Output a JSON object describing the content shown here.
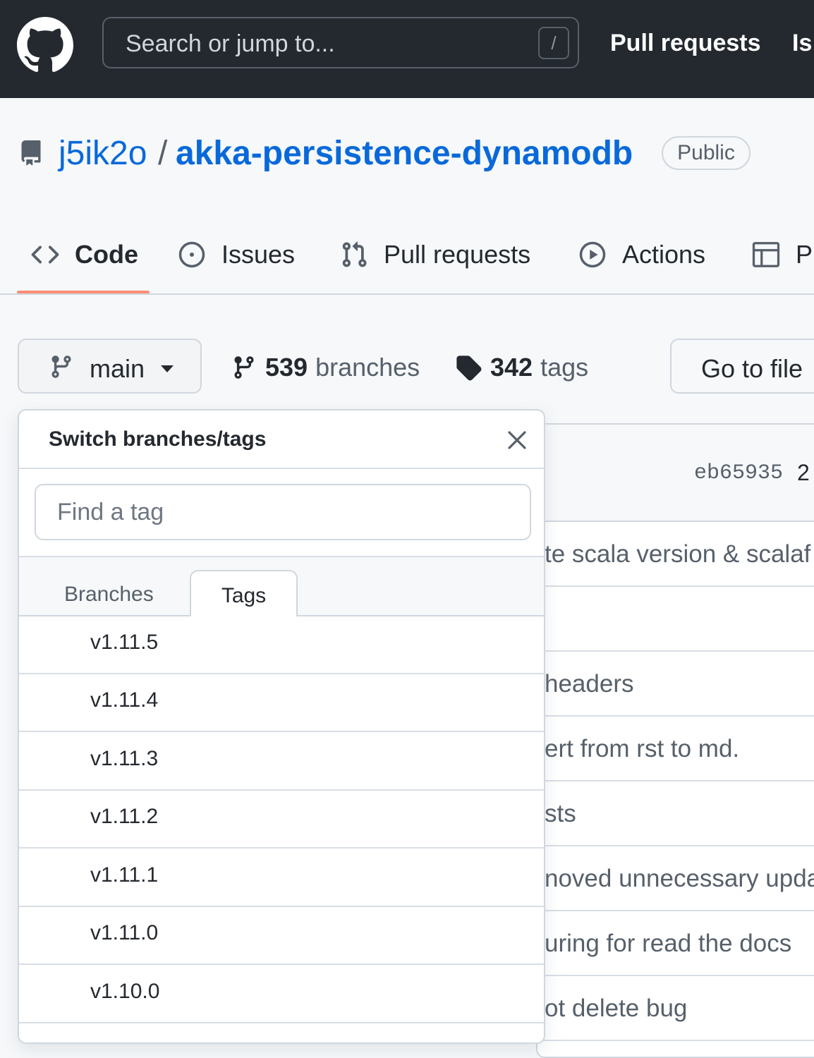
{
  "header": {
    "search_placeholder": "Search or jump to...",
    "search_shortcut": "/",
    "nav": [
      "Pull requests",
      "Is"
    ]
  },
  "repo": {
    "owner": "j5ik2o",
    "separator": "/",
    "name": "akka-persistence-dynamodb",
    "visibility": "Public"
  },
  "tabs": [
    {
      "label": "Code",
      "icon": "code-icon",
      "active": true
    },
    {
      "label": "Issues",
      "icon": "issue-opened-icon"
    },
    {
      "label": "Pull requests",
      "icon": "git-pull-request-icon"
    },
    {
      "label": "Actions",
      "icon": "play-icon"
    },
    {
      "label": "P",
      "icon": "table-icon"
    }
  ],
  "branch_bar": {
    "current_branch": "main",
    "branches_count": "539",
    "branches_label": "branches",
    "tags_count": "342",
    "tags_label": "tags",
    "go_to_file": "Go to file"
  },
  "file_list": {
    "commit_sha": "eb65935",
    "commit_count": "2",
    "rows": [
      "te scala version & scalaf",
      "",
      " headers",
      "ert from rst to md.",
      "sts",
      "noved unnecessary upda",
      "uring for read the docs",
      "ot delete bug"
    ]
  },
  "dropdown": {
    "title": "Switch branches/tags",
    "filter_placeholder": "Find a tag",
    "tabs": [
      "Branches",
      "Tags"
    ],
    "active_tab": "Tags",
    "items": [
      "v1.11.5",
      "v1.11.4",
      "v1.11.3",
      "v1.11.2",
      "v1.11.1",
      "v1.11.0",
      "v1.10.0"
    ]
  },
  "colors": {
    "header_bg": "#24292f",
    "link_blue": "#0969da",
    "active_tab_underline": "#fd8c73",
    "border": "#d0d7de"
  }
}
